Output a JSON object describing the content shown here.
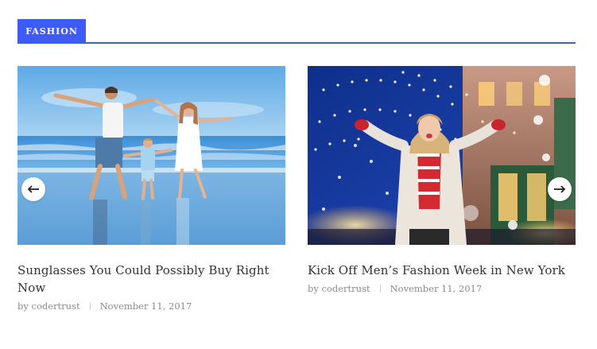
{
  "section": {
    "tag_label": "FASHION"
  },
  "posts": [
    {
      "title": "Sunglasses You Could Possibly Buy Right Now",
      "by_prefix": "by",
      "author": "codertrust",
      "date": "November 11, 2017"
    },
    {
      "title": "Kick Off Men’s Fashion Week in New York",
      "by_prefix": "by",
      "author": "codertrust",
      "date": "November 11, 2017"
    }
  ],
  "carousel": {
    "prev_icon": "arrow-left-icon",
    "next_icon": "arrow-right-icon"
  },
  "colors": {
    "accent": "#3f5bf6",
    "title_text": "#333333",
    "meta_text": "#8a8a8a"
  }
}
